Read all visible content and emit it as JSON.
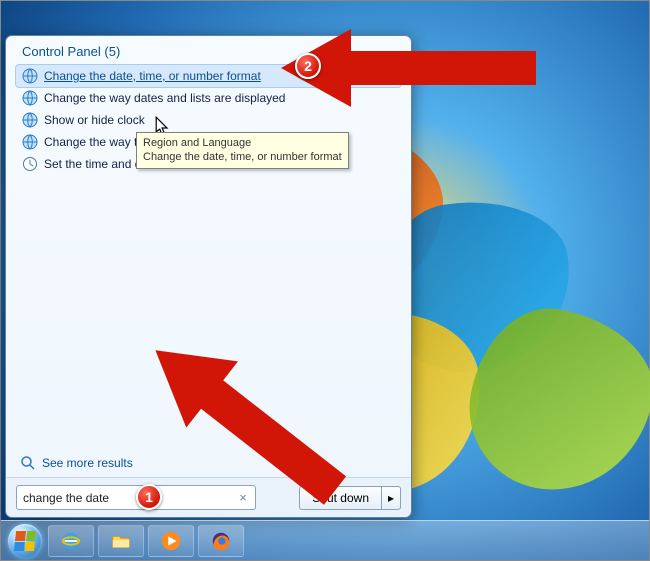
{
  "start_menu": {
    "heading": "Control Panel (5)",
    "items": [
      {
        "label": "Change the date, time, or number format",
        "icon": "globe",
        "selected": true
      },
      {
        "label": "Change the way dates and lists are displayed",
        "icon": "globe"
      },
      {
        "label": "Show or hide clock",
        "icon": "globe"
      },
      {
        "label": "Change the way time is displayed",
        "icon": "globe"
      },
      {
        "label": "Set the time and date",
        "icon": "clock"
      }
    ],
    "see_more": "See more results"
  },
  "tooltip": {
    "line1": "Region and Language",
    "line2": "Change the date, time, or number format"
  },
  "search": {
    "value": "change the date",
    "clear": "×"
  },
  "shutdown": {
    "label": "Shut down",
    "arrow": "▸"
  },
  "badges": {
    "one": "1",
    "two": "2"
  },
  "taskbar": {
    "ie": "ie-icon",
    "explorer": "explorer-icon",
    "wmp": "wmp-icon",
    "firefox": "firefox-icon"
  }
}
